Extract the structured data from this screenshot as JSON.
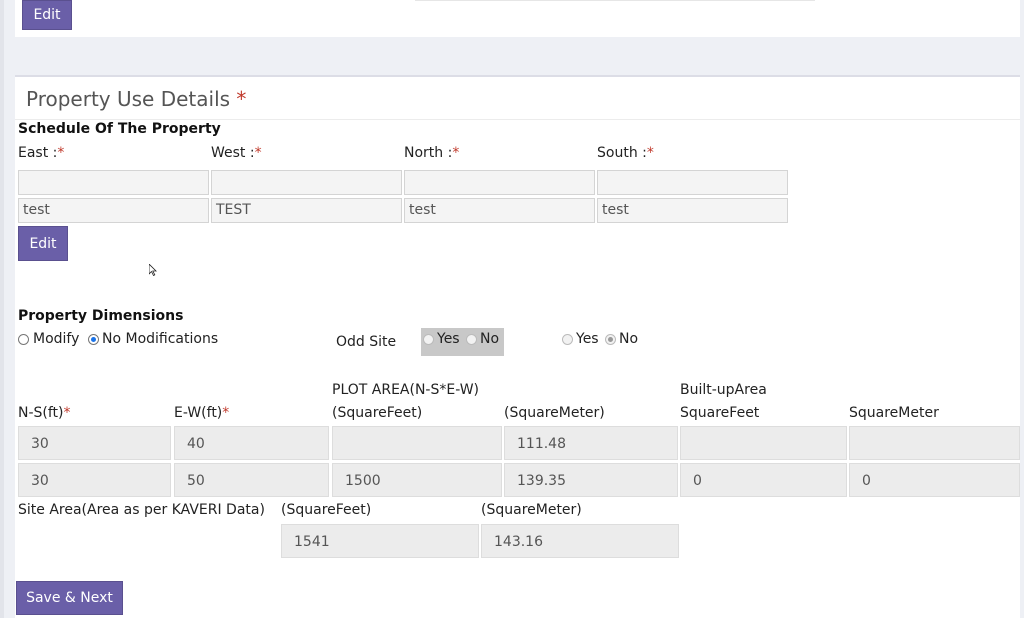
{
  "top_panel": {
    "edit_label": "Edit"
  },
  "property_use": {
    "title": "Property Use Details",
    "title_star": "*",
    "schedule": {
      "heading": "Schedule Of The Property",
      "required_mark": "*",
      "fields": [
        {
          "label": "East :",
          "top_value": "",
          "value": "test"
        },
        {
          "label": "West :",
          "top_value": "",
          "value": "TEST"
        },
        {
          "label": "North :",
          "top_value": "",
          "value": "test"
        },
        {
          "label": "South :",
          "top_value": "",
          "value": "test"
        }
      ],
      "edit_label": "Edit"
    },
    "dimensions": {
      "heading": "Property Dimensions",
      "modify_label": "Modify",
      "no_mod_label": "No Modifications",
      "odd_site_label": "Odd Site",
      "odd_yes": "Yes",
      "odd_no": "No",
      "yes2": "Yes",
      "no2": "No",
      "headers": {
        "ns": "N-S(ft)",
        "ew": "E-W(ft)",
        "plot_area": "PLOT AREA(N-S*E-W)",
        "sqft": "(SquareFeet)",
        "sqm": "(SquareMeter)",
        "builtup": "Built-upArea",
        "builtup_sqft": "SquareFeet",
        "builtup_sqm": "SquareMeter"
      },
      "rows": [
        {
          "ns": "30",
          "ew": "40",
          "sqft": "",
          "sqm": "111.48",
          "b_sqft": "",
          "b_sqm": ""
        },
        {
          "ns": "30",
          "ew": "50",
          "sqft": "1500",
          "sqm": "139.35",
          "b_sqft": "0",
          "b_sqm": "0"
        }
      ],
      "site_area_label": "Site Area(Area as per KAVERI Data)",
      "site_sqft_label": "(SquareFeet)",
      "site_sqm_label": "(SquareMeter)",
      "site_sqft": "1541",
      "site_sqm": "143.16"
    },
    "save_label": "Save & Next"
  }
}
